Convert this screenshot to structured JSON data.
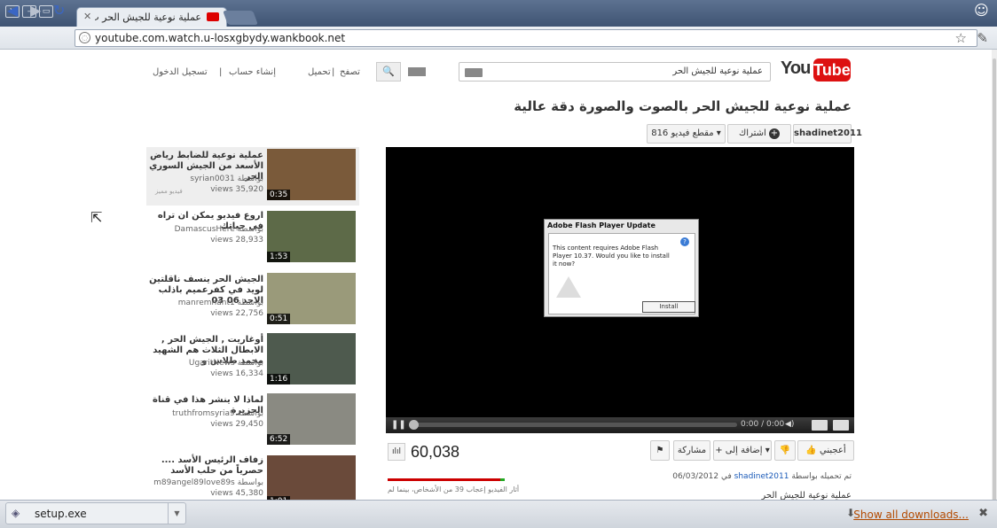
{
  "browser": {
    "tab_title": "عملية نوعية للجيش الحر ب...",
    "url": "youtube.com.watch.u-losxgbydy.wankbook.net",
    "window_buttons": [
      "close",
      "minimize",
      "maximize"
    ]
  },
  "header": {
    "logo_you": "You",
    "logo_tube": "Tube",
    "search_value": "عملية نوعية للجيش الحر",
    "browse": "تصفح",
    "upload": "تحميل",
    "create_account": "إنشاء حساب",
    "sign_in": "تسجيل الدخول",
    "sep": "|"
  },
  "video": {
    "title": "عملية نوعية للجيش الحر بالصوت والصورة دقة عالية",
    "channel": "shadinet2011",
    "subscribe": "اشتراك",
    "video_count": "816 مقطع فيديو ▾",
    "time": "0:00 / 0:00",
    "views": "60,038",
    "like": "أعجبني",
    "add_to": "+ إضافة إلى ▾",
    "share": "مشاركة",
    "flag": "⚑",
    "dislike": "👎",
    "uploaded_prefix": "تم تحميله بواسطة",
    "uploader": "shadinet2011",
    "uploaded_date": "في 06/03/2012",
    "description": "عملية نوعية للجيش الحر",
    "like_stat": "أثار الفيديو إعجاب 39 من الأشخاص، بينما لم",
    "like_ratio": 0.96
  },
  "flash_dialog": {
    "title": "Adobe Flash Player Update",
    "message": "This content requires Adobe Flash Player 10.37. Would you like to install it now?",
    "button": "Install"
  },
  "related": [
    {
      "title": "عملية نوعية للضابط رياض الأسعد من الجيش السوري الحر",
      "by": "بواسطة syrian0031",
      "views": "views 35,920",
      "duration": "0:35",
      "badge": "فيديو مميز"
    },
    {
      "title": "اروع فيديو يمكن ان تراه فى حياتك",
      "by": "بواسطة DamascusHere",
      "views": "views 28,933",
      "duration": "1:53"
    },
    {
      "title": "الجيش الحر ينسف ناقلتين لويد في كفرعميم باذلب الاحد 06 03",
      "by": "بواسطة manremnant1",
      "views": "views 22,756",
      "duration": "0:51"
    },
    {
      "title": "أوغاريت , الجيش الحر , الابطال الثلاث هم الشهيد محمد طلاس و",
      "by": "بواسطة UgaritNews",
      "views": "views 16,334",
      "duration": "1:16"
    },
    {
      "title": "لماذا لا ينشر هذا في قناة الجزيرة",
      "by": "بواسطة truthfromsyria9",
      "views": "views 29,450",
      "duration": "6:52"
    },
    {
      "title": "زفاف الرئيس الأسد .... حصرياً من حلب الأسد",
      "by": "بواسطة m89angel89love89s",
      "views": "views 45,380",
      "duration": "1:01"
    }
  ],
  "downloads": {
    "file": "setup.exe",
    "show_all": "Show all downloads..."
  },
  "colors": {
    "titlebar": "#4a5f7f",
    "yt_red": "#d11111",
    "download_link": "#b34a00"
  }
}
